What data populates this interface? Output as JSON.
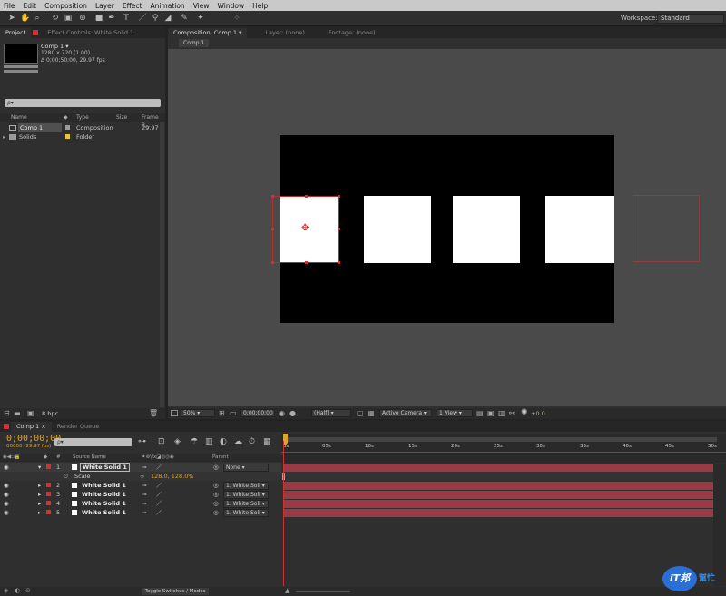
{
  "menu": [
    "File",
    "Edit",
    "Composition",
    "Layer",
    "Effect",
    "Animation",
    "View",
    "Window",
    "Help"
  ],
  "workspace": {
    "label": "Workspace:",
    "value": "Standard"
  },
  "left_tabs": {
    "project": "Project",
    "effect_controls": "Effect Controls: White Solid 1"
  },
  "project": {
    "comp_name": "Comp 1 ▾",
    "comp_info1": "1280 x 720 (1.00)",
    "comp_info2": "Δ 0;00;50;00, 29.97 fps",
    "search_placeholder": "ρ▾",
    "columns": [
      "Name",
      "Type",
      "Size",
      "Frame R..."
    ],
    "items": [
      {
        "name": "Comp 1",
        "type": "Composition",
        "frame": "29.97",
        "color": "#9a9a9a"
      },
      {
        "name": "Solids",
        "type": "Folder",
        "frame": "",
        "color": "#e6c83a"
      }
    ],
    "bpc": "8 bpc"
  },
  "viewer_tabs": {
    "comp": "Composition: Comp 1",
    "layer": "Layer: (none)",
    "footage": "Footage: (none)",
    "subtab": "Comp 1"
  },
  "viewer_bar": {
    "zoom": "50%",
    "timecode": "0;00;00;00",
    "resolution": "(Half)",
    "camera": "Active Camera",
    "views": "1 View",
    "exposure": "+0.0"
  },
  "timeline_tabs": {
    "comp": "Comp 1",
    "render": "Render Queue"
  },
  "timeline": {
    "timecode": "0;00;00;00",
    "fps": "00000 (29.97 fps)",
    "search_placeholder": "ρ▾",
    "col_num": "#",
    "col_source": "Source Name",
    "col_parent": "Parent",
    "layers": [
      {
        "num": "1",
        "name": "White Solid 1",
        "parent": "None"
      },
      {
        "num": "2",
        "name": "White Solid 1",
        "parent": "1. White Soli"
      },
      {
        "num": "3",
        "name": "White Solid 1",
        "parent": "1. White Soli"
      },
      {
        "num": "4",
        "name": "White Solid 1",
        "parent": "1. White Soli"
      },
      {
        "num": "5",
        "name": "White Solid 1",
        "parent": "1. White Soli"
      }
    ],
    "scale_label": "Scale",
    "scale_value": "128.0, 128.0%",
    "ruler": [
      "0s",
      "05s",
      "10s",
      "15s",
      "20s",
      "25s",
      "30s",
      "35s",
      "40s",
      "45s",
      "50s"
    ],
    "toggle_label": "Toggle Switches / Modes",
    "label_color": "#c03a3a",
    "bar_color": "#9a3a44"
  },
  "watermark": {
    "main": "iT邦",
    "sub": "幫忙"
  }
}
